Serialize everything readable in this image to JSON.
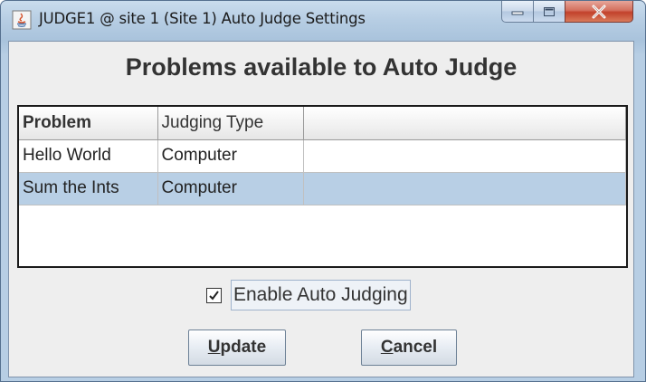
{
  "window": {
    "title": "JUDGE1 @ site 1 (Site 1) Auto Judge Settings",
    "controls": {
      "minimize": "minimize-icon",
      "maximize": "maximize-icon",
      "close": "close-icon"
    }
  },
  "panel": {
    "heading": "Problems available to Auto Judge"
  },
  "table": {
    "columns": [
      "Problem",
      "Judging Type",
      ""
    ],
    "rows": [
      {
        "problem": "Hello World",
        "judging_type": "Computer",
        "extra": "",
        "selected": false
      },
      {
        "problem": "Sum the Ints",
        "judging_type": "Computer",
        "extra": "",
        "selected": true
      }
    ]
  },
  "options": {
    "enable_auto_judging": {
      "label": "Enable Auto Judging",
      "checked": true
    }
  },
  "buttons": {
    "update": {
      "mnemonic": "U",
      "rest": "pdate"
    },
    "cancel": {
      "mnemonic": "C",
      "rest": "ancel"
    }
  },
  "colors": {
    "selected_row": "#b8cfe5",
    "close_button": "#c2412b",
    "title_bar": "#b6cde3"
  }
}
